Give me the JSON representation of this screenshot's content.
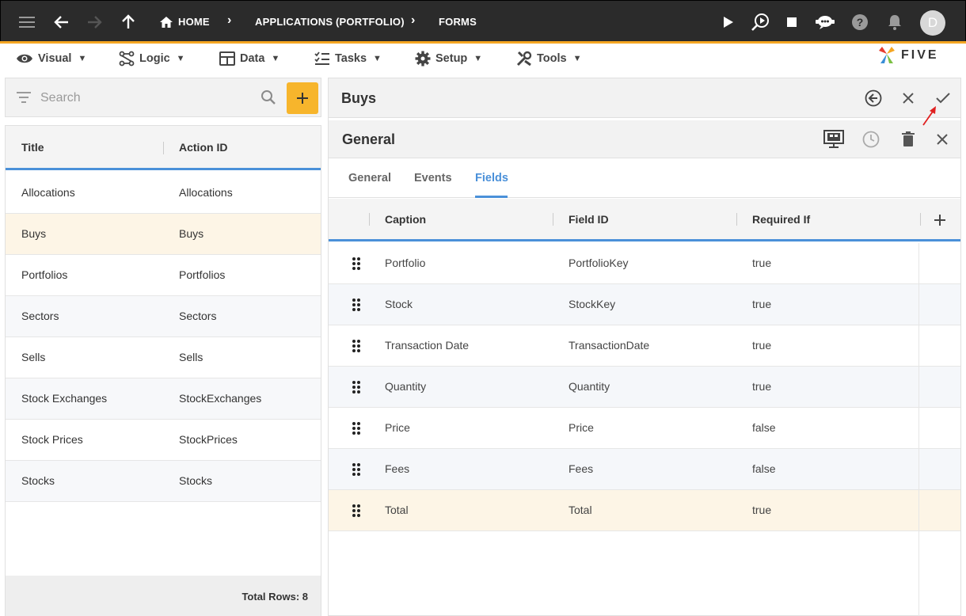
{
  "topbar": {
    "breadcrumbs": [
      "HOME",
      "APPLICATIONS (PORTFOLIO)",
      "FORMS"
    ],
    "avatar_letter": "D",
    "accent_color": "#f5a623"
  },
  "menu": [
    {
      "label": "Visual",
      "icon": "eye-icon"
    },
    {
      "label": "Logic",
      "icon": "logic-icon"
    },
    {
      "label": "Data",
      "icon": "table-icon"
    },
    {
      "label": "Tasks",
      "icon": "tasks-icon"
    },
    {
      "label": "Setup",
      "icon": "gear-icon"
    },
    {
      "label": "Tools",
      "icon": "tools-icon"
    }
  ],
  "logo": {
    "text": "FIVE"
  },
  "left": {
    "search_placeholder": "Search",
    "columns": [
      "Title",
      "Action ID"
    ],
    "rows": [
      {
        "title": "Allocations",
        "action_id": "Allocations"
      },
      {
        "title": "Buys",
        "action_id": "Buys"
      },
      {
        "title": "Portfolios",
        "action_id": "Portfolios"
      },
      {
        "title": "Sectors",
        "action_id": "Sectors"
      },
      {
        "title": "Sells",
        "action_id": "Sells"
      },
      {
        "title": "Stock Exchanges",
        "action_id": "StockExchanges"
      },
      {
        "title": "Stock Prices",
        "action_id": "StockPrices"
      },
      {
        "title": "Stocks",
        "action_id": "Stocks"
      }
    ],
    "selected_index": 1,
    "total_rows_label": "Total Rows: 8"
  },
  "form": {
    "title": "Buys",
    "sub_title": "General",
    "tabs": [
      "General",
      "Events",
      "Fields"
    ],
    "active_tab": "Fields",
    "columns": [
      "Caption",
      "Field ID",
      "Required If"
    ],
    "rows": [
      {
        "caption": "Portfolio",
        "field_id": "PortfolioKey",
        "required_if": "true"
      },
      {
        "caption": "Stock",
        "field_id": "StockKey",
        "required_if": "true"
      },
      {
        "caption": "Transaction Date",
        "field_id": "TransactionDate",
        "required_if": "true"
      },
      {
        "caption": "Quantity",
        "field_id": "Quantity",
        "required_if": "true"
      },
      {
        "caption": "Price",
        "field_id": "Price",
        "required_if": "false"
      },
      {
        "caption": "Fees",
        "field_id": "Fees",
        "required_if": "false"
      },
      {
        "caption": "Total",
        "field_id": "Total",
        "required_if": "true"
      }
    ],
    "selected_index": 6
  },
  "colors": {
    "selected_row": "#fdf5e6",
    "alt_row": "#f5f7fa",
    "header_underline": "#4a90d9",
    "add_button": "#f7b52c",
    "annotation_arrow": "#e02020"
  }
}
